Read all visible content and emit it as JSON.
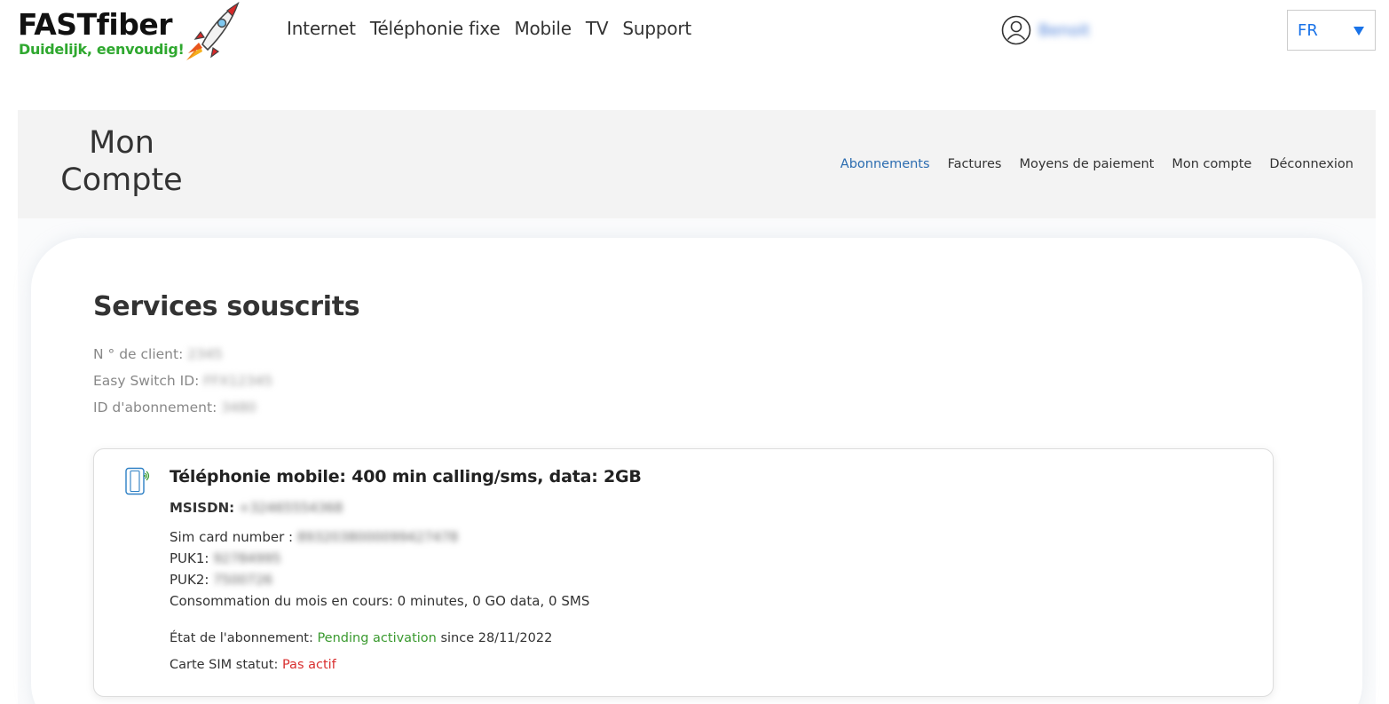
{
  "header": {
    "logo": {
      "brand": "FASTfiber",
      "tagline": "Duidelijk, eenvoudig!"
    },
    "nav": [
      {
        "label": "Internet"
      },
      {
        "label": "Téléphonie fixe"
      },
      {
        "label": "Mobile"
      },
      {
        "label": "TV"
      },
      {
        "label": "Support"
      }
    ],
    "user": {
      "name": "Benoit"
    },
    "language": {
      "selected": "FR"
    }
  },
  "account": {
    "title_line1": "Mon",
    "title_line2": "Compte",
    "nav": [
      {
        "label": "Abonnements",
        "active": true
      },
      {
        "label": "Factures"
      },
      {
        "label": "Moyens de paiement"
      },
      {
        "label": "Mon compte"
      },
      {
        "label": "Déconnexion"
      }
    ]
  },
  "services": {
    "title": "Services souscrits",
    "client_number_label": "N ° de client:",
    "client_number_value": "2345",
    "easy_switch_label": "Easy Switch ID:",
    "easy_switch_value": "FFX12345",
    "subscription_id_label": "ID d'abonnement:",
    "subscription_id_value": "3480"
  },
  "subscription": {
    "title": "Téléphonie mobile: 400 min calling/sms, data: 2GB",
    "msisdn_label": "MSISDN:",
    "msisdn_value": "+32465554368",
    "sim_label": "Sim card number :",
    "sim_value": "8932038000099427478",
    "puk1_label": "PUK1:",
    "puk1_value": "92784995",
    "puk2_label": "PUK2:",
    "puk2_value": "7500726",
    "consumption": "Consommation du mois en cours: 0 minutes, 0 GO data, 0 SMS",
    "state_label": "État de l'abonnement:",
    "state_value": "Pending activation",
    "state_since": "since 28/11/2022",
    "sim_status_label": "Carte SIM statut:",
    "sim_status_value": "Pas actif"
  },
  "colors": {
    "accent_blue": "#1a73e8",
    "active_link": "#2b6cb0",
    "logo_green": "#2fa82f",
    "status_green": "#3a9a2f",
    "status_red": "#d93030"
  },
  "icons": [
    "rocket-icon",
    "user-circle-icon",
    "chevron-down-icon",
    "mobile-phone-icon"
  ]
}
